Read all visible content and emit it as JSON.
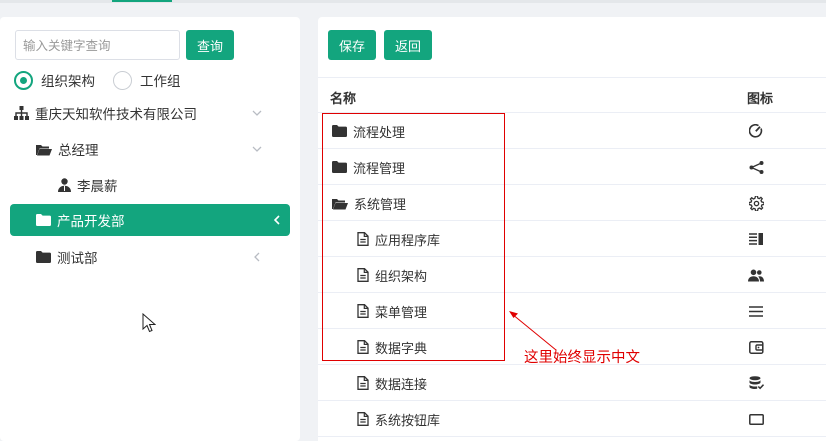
{
  "search": {
    "placeholder": "输入关键字查询",
    "button_label": "查询"
  },
  "radios": [
    {
      "label": "组织架构",
      "checked": true
    },
    {
      "label": "工作组",
      "checked": false
    }
  ],
  "org_tree": [
    {
      "label": "重庆天知软件技术有限公司",
      "icon": "sitemap-icon",
      "expanded": true
    },
    {
      "label": "总经理",
      "icon": "folder-open-icon",
      "expanded": true
    },
    {
      "label": "李晨薪",
      "icon": "user-icon"
    },
    {
      "label": "产品开发部",
      "icon": "folder-icon",
      "selected": true
    },
    {
      "label": "测试部",
      "icon": "folder-icon"
    }
  ],
  "toolbar": {
    "save_label": "保存",
    "back_label": "返回"
  },
  "table": {
    "columns": [
      "名称",
      "图标"
    ],
    "rows": [
      {
        "name": "流程处理",
        "level": 0,
        "type": "folder",
        "icon": "gauge-icon"
      },
      {
        "name": "流程管理",
        "level": 0,
        "type": "folder",
        "icon": "share-nodes-icon"
      },
      {
        "name": "系统管理",
        "level": 0,
        "type": "folder-open",
        "icon": "gear-icon"
      },
      {
        "name": "应用程序库",
        "level": 1,
        "type": "file",
        "icon": "list-bars-icon"
      },
      {
        "name": "组织架构",
        "level": 1,
        "type": "file",
        "icon": "users-icon"
      },
      {
        "name": "菜单管理",
        "level": 1,
        "type": "file",
        "icon": "menu-icon"
      },
      {
        "name": "数据字典",
        "level": 1,
        "type": "file",
        "icon": "wallet-icon"
      },
      {
        "name": "数据连接",
        "level": 1,
        "type": "file",
        "icon": "database-icon"
      },
      {
        "name": "系统按钮库",
        "level": 1,
        "type": "file",
        "icon": "rectangle-icon"
      }
    ]
  },
  "annotation": {
    "text": "这里始终显示中文",
    "color": "#e00000"
  },
  "colors": {
    "accent": "#13a57e"
  }
}
